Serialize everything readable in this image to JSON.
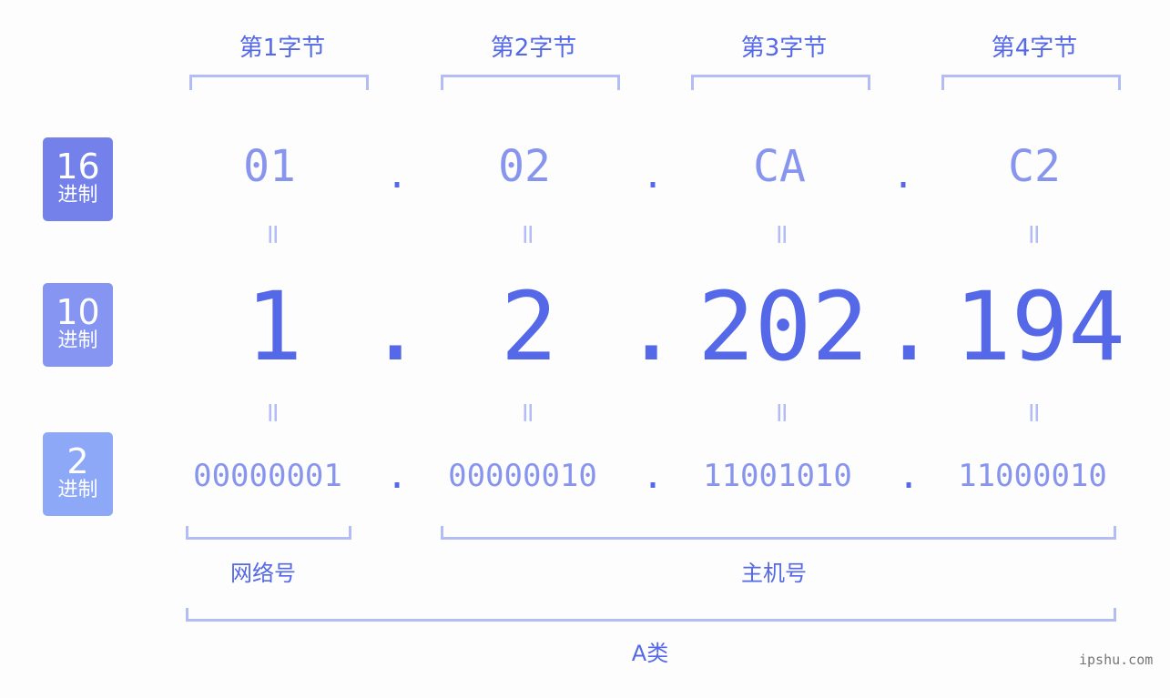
{
  "byte_headers": [
    "第1字节",
    "第2字节",
    "第3字节",
    "第4字节"
  ],
  "badges": [
    {
      "num": "16",
      "label": "进制",
      "color": "#7581ea"
    },
    {
      "num": "10",
      "label": "进制",
      "color": "#8595f1"
    },
    {
      "num": "2",
      "label": "进制",
      "color": "#8ea8f8"
    }
  ],
  "hex": [
    "01",
    "02",
    "CA",
    "C2"
  ],
  "decimal": [
    "1",
    "2",
    "202",
    "194"
  ],
  "binary": [
    "00000001",
    "00000010",
    "11001010",
    "11000010"
  ],
  "separator": ".",
  "equals": "=",
  "network_label": "网络号",
  "host_label": "主机号",
  "class_label": "A类",
  "watermark": "ipshu.com"
}
